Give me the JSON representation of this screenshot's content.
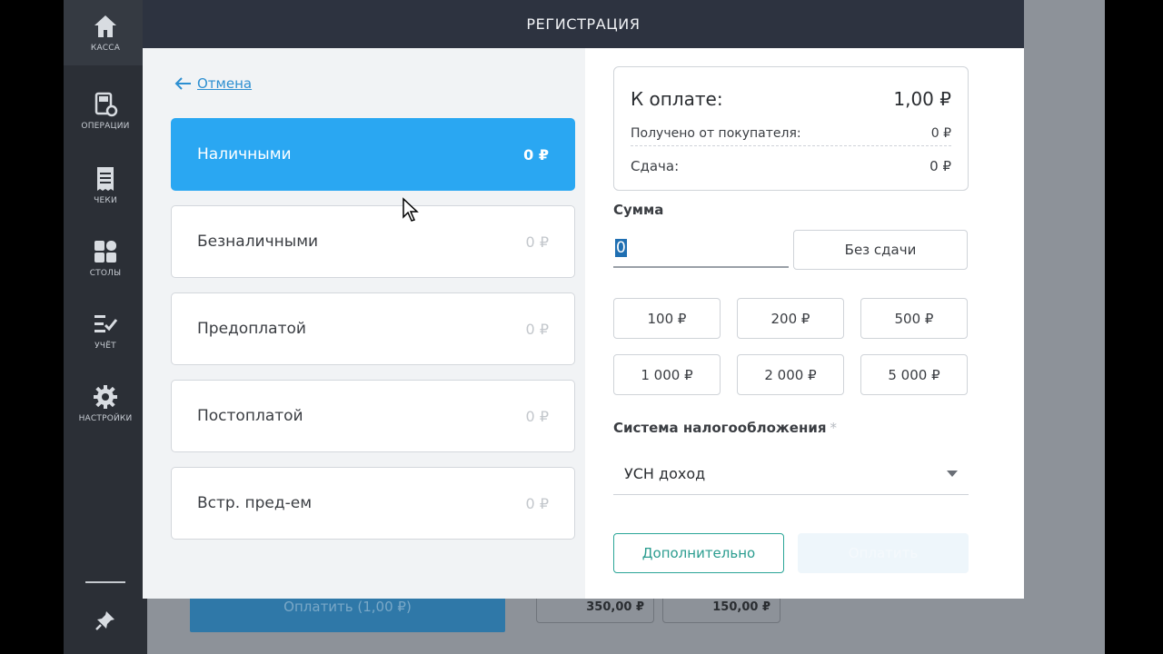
{
  "sidebar": {
    "items": [
      {
        "label": "КАССА",
        "icon": "home-icon"
      },
      {
        "label": "ОПЕРАЦИИ",
        "icon": "terminal-gear-icon"
      },
      {
        "label": "ЧЕКИ",
        "icon": "receipt-icon"
      },
      {
        "label": "СТОЛЫ",
        "icon": "grid-icon"
      },
      {
        "label": "УЧЁТ",
        "icon": "checklist-icon"
      },
      {
        "label": "НАСТРОЙКИ",
        "icon": "gear-icon"
      }
    ],
    "bottom_icon": "pin-icon"
  },
  "background": {
    "pay_button": "Оплатить (1,00 ₽)",
    "chips": [
      "350,00 ₽",
      "150,00 ₽"
    ],
    "refresh_icon": "refresh-icon"
  },
  "modal": {
    "title": "РЕГИСТРАЦИЯ",
    "cancel": {
      "label": "Отмена",
      "icon": "arrow-left-icon"
    },
    "payment_methods": [
      {
        "label": "Наличными",
        "amount": "0 ₽",
        "selected": true
      },
      {
        "label": "Безналичными",
        "amount": "0 ₽",
        "selected": false
      },
      {
        "label": "Предоплатой",
        "amount": "0 ₽",
        "selected": false
      },
      {
        "label": "Постоплатой",
        "amount": "0 ₽",
        "selected": false
      },
      {
        "label": "Встр. пред-ем",
        "amount": "0 ₽",
        "selected": false
      }
    ],
    "summary": {
      "to_pay_label": "К оплате:",
      "to_pay_value": "1,00 ₽",
      "received_label": "Получено от покупателя:",
      "received_value": "0 ₽",
      "change_label": "Сдача:",
      "change_value": "0 ₽"
    },
    "amount": {
      "label": "Сумма",
      "value": "0",
      "no_change_button": "Без сдачи"
    },
    "quick_amounts": [
      "100 ₽",
      "200 ₽",
      "500 ₽",
      "1 000 ₽",
      "2 000 ₽",
      "5 000 ₽"
    ],
    "tax": {
      "label": "Система налогообложения",
      "required_mark": "*",
      "value": "УСН доход"
    },
    "buttons": {
      "more": "Дополнительно",
      "pay": "Оплатить"
    }
  },
  "colors": {
    "header_bg": "#2d3340",
    "selected_method": "#2aa7f2",
    "link": "#2d8fd1",
    "secondary_button": "#2aa597"
  }
}
